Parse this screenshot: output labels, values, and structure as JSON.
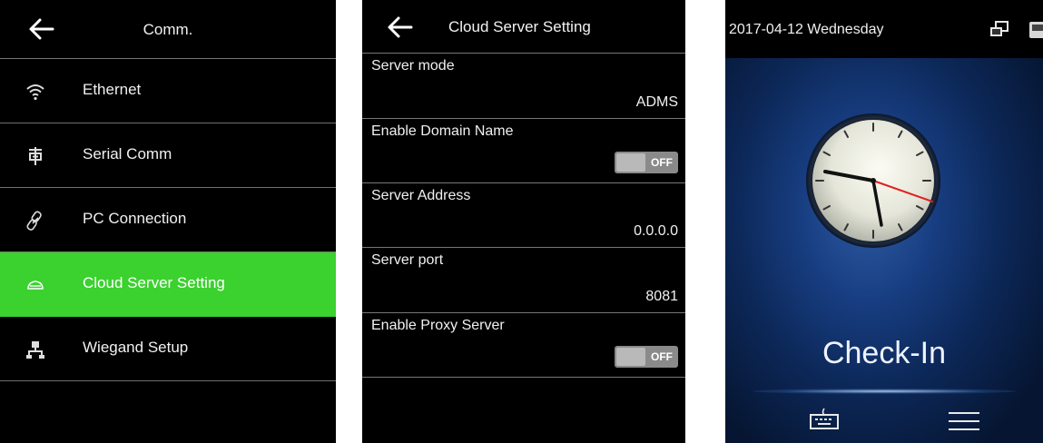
{
  "comm_screen": {
    "title": "Comm.",
    "back_icon": "back-arrow-icon",
    "items": [
      {
        "label": "Ethernet",
        "icon": "wifi-icon",
        "active": false
      },
      {
        "label": "Serial Comm",
        "icon": "serial-plug-icon",
        "active": false
      },
      {
        "label": "PC Connection",
        "icon": "link-icon",
        "active": false
      },
      {
        "label": "Cloud Server Setting",
        "icon": "cloud-icon",
        "active": true
      },
      {
        "label": "Wiegand Setup",
        "icon": "network-icon",
        "active": false
      }
    ],
    "active_color": "#3bd12f"
  },
  "cloud_screen": {
    "title": "Cloud Server Setting",
    "back_icon": "back-arrow-icon",
    "rows": [
      {
        "label": "Server mode",
        "value": "ADMS"
      },
      {
        "label": "Enable Domain Name",
        "toggle": "OFF"
      },
      {
        "label": "Server Address",
        "value": "0.0.0.0"
      },
      {
        "label": "Server port",
        "value": "8081"
      },
      {
        "label": "Enable Proxy Server",
        "toggle": "OFF"
      }
    ]
  },
  "main_screen": {
    "date": "2017-04-12  Wednesday",
    "status_icons": [
      "network-status-icon",
      "device-status-icon"
    ],
    "clock_icon": "analog-clock-icon",
    "state": "Check-In",
    "bottom_icons": [
      "keyboard-icon",
      "menu-icon"
    ]
  }
}
